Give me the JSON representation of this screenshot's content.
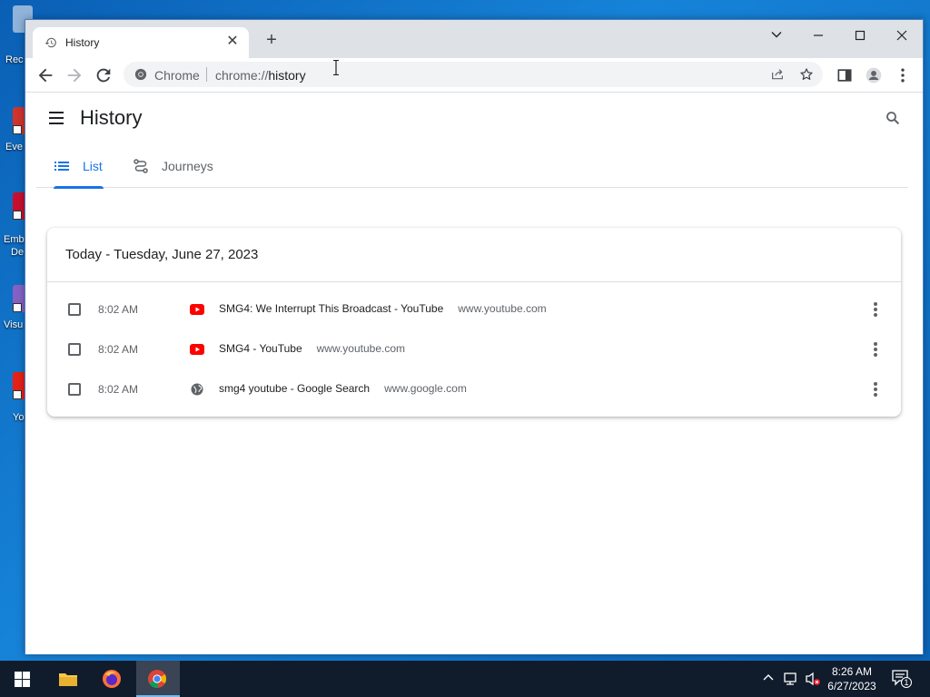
{
  "desktop": {
    "icons": [
      {
        "label": "Rec",
        "color": "#8fb3d9"
      },
      {
        "label": "Eve",
        "color": "#d0342c"
      },
      {
        "label": "Emb",
        "label2": "De",
        "color": "#c8102e"
      },
      {
        "label": "Visu",
        "color": "#8661c5"
      },
      {
        "label": "Yo",
        "color": "#e62117"
      }
    ]
  },
  "browser": {
    "tab": {
      "title": "History",
      "icon": "history-icon"
    },
    "omnibox": {
      "site_label": "Chrome",
      "url_scheme": "chrome://",
      "url_path": "history"
    },
    "accent": "#1a73e8"
  },
  "history": {
    "title": "History",
    "tabs": [
      {
        "label": "List",
        "icon": "list-icon",
        "active": true
      },
      {
        "label": "Journeys",
        "icon": "journeys-icon",
        "active": false
      }
    ],
    "date_header": "Today - Tuesday, June 27, 2023",
    "entries": [
      {
        "time": "8:02 AM",
        "favicon": "youtube-icon",
        "title": "SMG4: We Interrupt This Broadcast - YouTube",
        "domain": "www.youtube.com"
      },
      {
        "time": "8:02 AM",
        "favicon": "youtube-icon",
        "title": "SMG4 - YouTube",
        "domain": "www.youtube.com"
      },
      {
        "time": "8:02 AM",
        "favicon": "globe-icon",
        "title": "smg4 youtube - Google Search",
        "domain": "www.google.com"
      }
    ]
  },
  "taskbar": {
    "time": "8:26 AM",
    "date": "6/27/2023",
    "notification_count": "1"
  }
}
